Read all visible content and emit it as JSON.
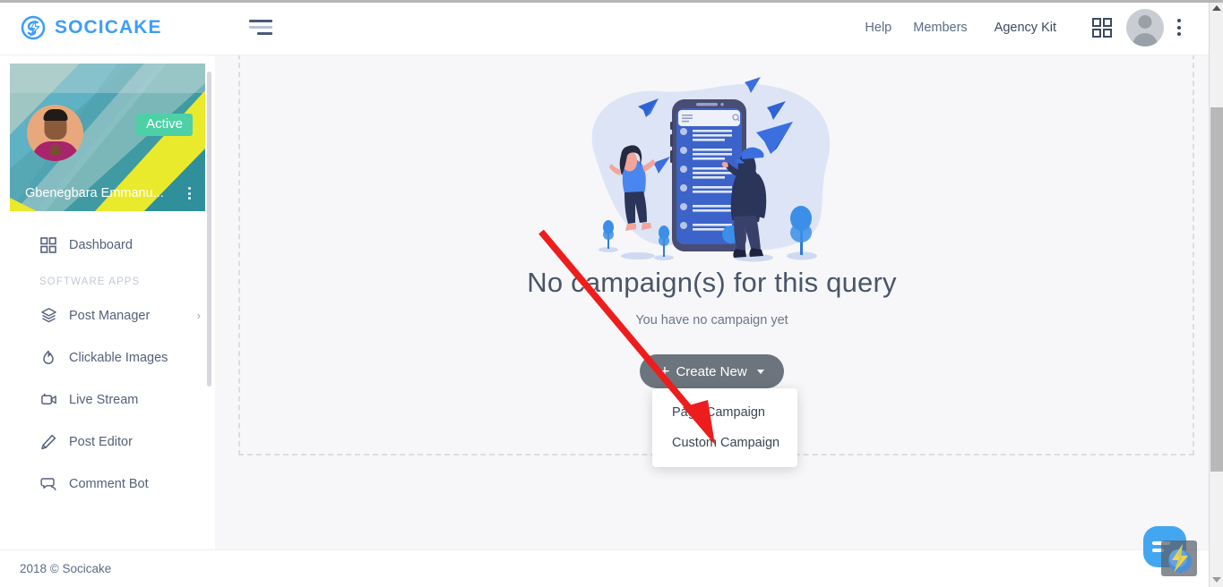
{
  "brand": {
    "name": "SOCICAKE",
    "logo_icon": "socicake-s-logo",
    "color": "#3d9dfa"
  },
  "topbar": {
    "menu_toggle_icon": "hamburger-menu-icon",
    "links": [
      {
        "label": "Help",
        "style": "muted"
      },
      {
        "label": "Members",
        "style": "muted"
      },
      {
        "label": "Agency Kit",
        "style": "dark"
      }
    ],
    "apps_icon": "grid-apps-icon",
    "avatar_icon": "user-avatar",
    "more_icon": "vertical-kebab-icon"
  },
  "sidebar": {
    "profile": {
      "name": "Gbenegbara Emmanu...",
      "status_badge": "Active",
      "avatar_icon": "profile-photo",
      "more_icon": "profile-more-icon"
    },
    "items": [
      {
        "label": "Dashboard",
        "icon": "grid-dashboard-icon",
        "chevron": ""
      },
      {
        "label": "Post Manager",
        "icon": "layers-icon",
        "chevron": "›"
      },
      {
        "label": "Clickable Images",
        "icon": "flame-icon",
        "chevron": ""
      },
      {
        "label": "Live Stream",
        "icon": "video-camera-icon",
        "chevron": ""
      },
      {
        "label": "Post Editor",
        "icon": "pencil-icon",
        "chevron": ""
      },
      {
        "label": "Comment Bot",
        "icon": "chat-bubbles-icon",
        "chevron": ""
      }
    ],
    "section_label": "SOFTWARE APPS"
  },
  "footer": {
    "text": "2018 © Socicake"
  },
  "main": {
    "illustration_icon": "empty-state-phone-illustration",
    "title": "No campaign(s) for this query",
    "subtitle": "You have no campaign yet",
    "create_button": {
      "label": "Create New",
      "plus": "+",
      "caret_icon": "caret-down-icon"
    },
    "dropdown": {
      "items": [
        {
          "label": "Page Campaign"
        },
        {
          "label": "Custom Campaign"
        }
      ]
    }
  },
  "annotation": {
    "arrow_icon": "red-pointer-arrow",
    "color": "#ee1d1d"
  },
  "chat_widget": {
    "icon": "chat-message-icon",
    "badge_icon": "lightning-bolt-badge"
  },
  "scrollbar": {
    "up_icon": "scroll-up-arrow",
    "down_icon": "scroll-down-arrow",
    "thumb_icon": "scroll-thumb"
  }
}
